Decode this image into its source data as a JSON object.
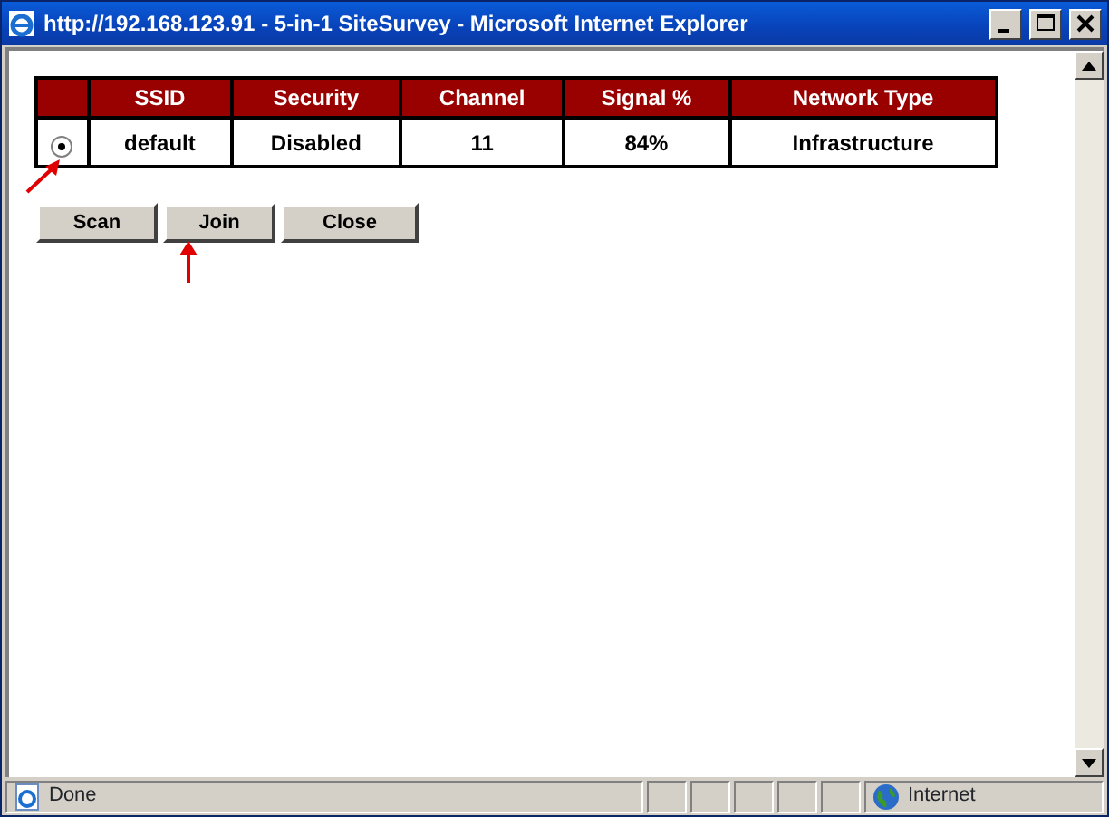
{
  "window": {
    "title": "http://192.168.123.91 - 5-in-1 SiteSurvey - Microsoft Internet Explorer"
  },
  "table": {
    "columns": [
      "",
      "SSID",
      "Security",
      "Channel",
      "Signal %",
      "Network Type"
    ],
    "rows": [
      {
        "selected": true,
        "cells": [
          "",
          "default",
          "Disabled",
          "11",
          "84%",
          "Infrastructure"
        ]
      }
    ]
  },
  "buttons": [
    "Scan",
    "Join",
    "Close"
  ],
  "status_bar": {
    "text": "Done",
    "zone": "Internet"
  }
}
